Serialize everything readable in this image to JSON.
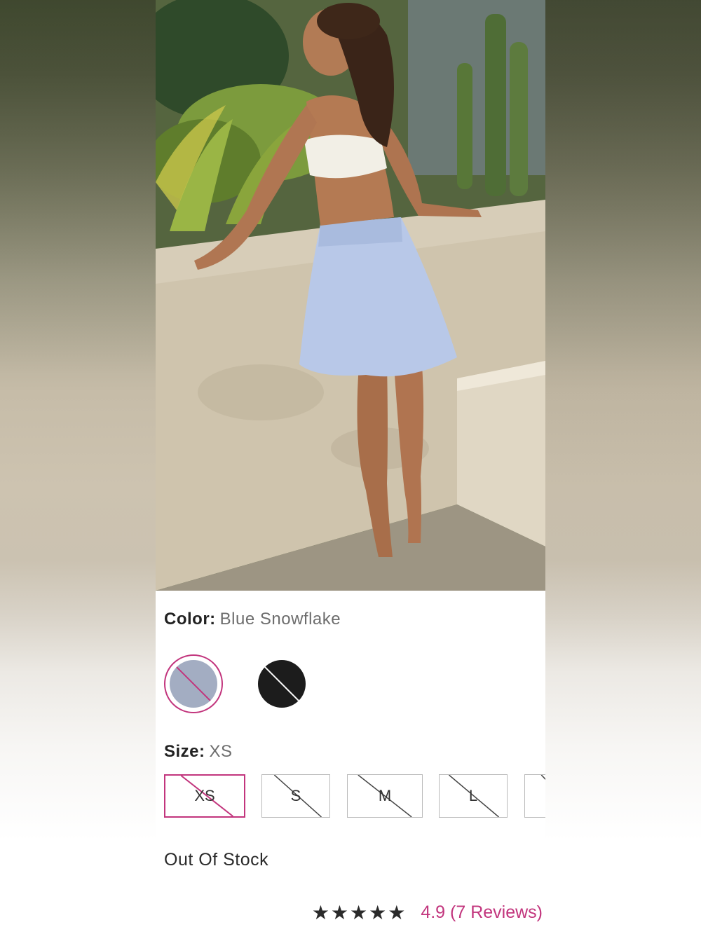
{
  "product": {
    "image_alt": "Model wearing skirt"
  },
  "color": {
    "label": "Color:",
    "selected_value": "Blue Snowflake",
    "swatches": [
      {
        "name": "Blue Snowflake",
        "color": "#a3adc2",
        "selected": true,
        "available": false
      },
      {
        "name": "Black",
        "color": "#1c1c1c",
        "selected": false,
        "available": false
      }
    ]
  },
  "size": {
    "label": "Size:",
    "selected_value": "XS",
    "options": [
      "XS",
      "S",
      "M",
      "L",
      ""
    ]
  },
  "stock_status": "Out Of Stock",
  "reviews": {
    "stars": "★★★★★",
    "rating_text": "4.9 (7 Reviews)"
  },
  "colors": {
    "accent": "#c2357d",
    "text": "#222222",
    "muted": "#6d6d6d"
  }
}
